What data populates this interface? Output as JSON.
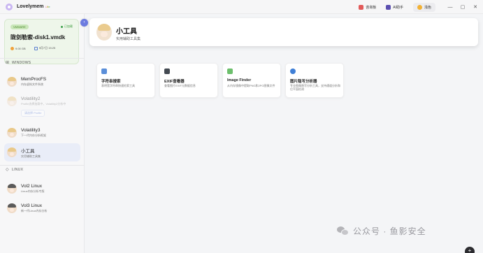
{
  "titlebar": {
    "app_name": "Lovelymem",
    "app_sub": "Lite",
    "buttons": {
      "open_chat": "咨询板",
      "ai_assistant": "AI助手",
      "theme": "浅色"
    },
    "window_controls": {
      "minimize": "—",
      "maximize": "▢",
      "close": "✕"
    }
  },
  "disk": {
    "badge": "VMWARE",
    "status": "已加载",
    "name": "陇剑勒索-disk1.vmdk",
    "size": "9.00 GB",
    "date": "9月7日 15:25"
  },
  "sidebar": {
    "windows_header": "WINDOWS",
    "linux_header": "LINUX",
    "windows_items": [
      {
        "title": "MemProcFS",
        "sub": "内存虚拟文件系统"
      },
      {
        "title": "Volatility2",
        "sub": "Profile选择加载中，Volatility2分析中",
        "profile_button": "请选择 Profile"
      },
      {
        "title": "Volatility3",
        "sub": "下一代内存分析框架"
      },
      {
        "title": "小工具",
        "sub": "实用辅助工具集"
      }
    ],
    "linux_items": [
      {
        "title": "Vol2 Linux",
        "sub": "Linux内存分析专版"
      },
      {
        "title": "Vol3 Linux",
        "sub": "新一代Linux内存分析"
      }
    ],
    "collapse_glyph": "‹"
  },
  "header": {
    "title": "小工具",
    "subtitle": "实用辅助工具集"
  },
  "tools": [
    {
      "name": "字符串搜索",
      "desc": "表明宽字符串快速检索工具",
      "icon": "text-icon",
      "color": "#5b8fd9"
    },
    {
      "name": "EXIF查看器",
      "desc": "查看图片EXIF元数据信息",
      "icon": "camera-icon",
      "color": "#444a52"
    },
    {
      "name": "Image Finder",
      "desc": "从内存镜像中提取PNG和JPG图像文件",
      "icon": "image-icon",
      "color": "#6cbf6c"
    },
    {
      "name": "图片隐写分析器",
      "desc": "专业图像隐写分析工具，支持通道分析和位平面检测",
      "icon": "magnifier-icon",
      "color": "#3f7fd6"
    }
  ],
  "watermark": "公众号 · 鱼影安全",
  "fab_glyph": "+"
}
